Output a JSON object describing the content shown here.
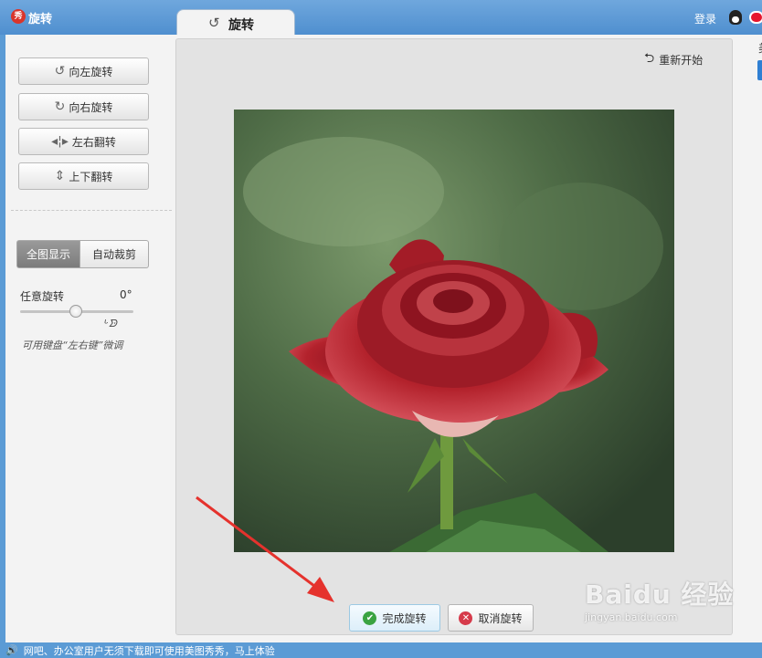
{
  "titlebar": {
    "app_logo": "秀",
    "app_title": "旋转",
    "tab_label": "旋转",
    "login": "登录"
  },
  "left_panel": {
    "buttons": [
      {
        "label": "向左旋转",
        "icon": "rotate-left-icon"
      },
      {
        "label": "向右旋转",
        "icon": "rotate-right-icon"
      },
      {
        "label": "左右翻转",
        "icon": "flip-horizontal-icon"
      },
      {
        "label": "上下翻转",
        "icon": "flip-vertical-icon"
      }
    ],
    "view_modes": [
      "全图显示",
      "自动裁剪"
    ],
    "selected_view": "全图显示",
    "rotation_label": "任意旋转",
    "rotation_value": "0°",
    "hint": "可用键盘“左右键”微调"
  },
  "canvas": {
    "restart": "重新开始"
  },
  "actions": {
    "confirm": "完成旋转",
    "cancel": "取消旋转"
  },
  "right_strip": {
    "char": "美"
  },
  "watermark": {
    "main": "Baidu 经验",
    "sub": "jingyan.baidu.com"
  },
  "statusbar": {
    "text": "网吧、办公室用户无须下载即可使用美图秀秀，马上体验"
  },
  "colors": {
    "titlebar": "#5b9bd5",
    "rose": "#b3222c",
    "confirm_icon": "#3aa341",
    "cancel_icon": "#d63a4a",
    "arrow": "#e5322d"
  }
}
